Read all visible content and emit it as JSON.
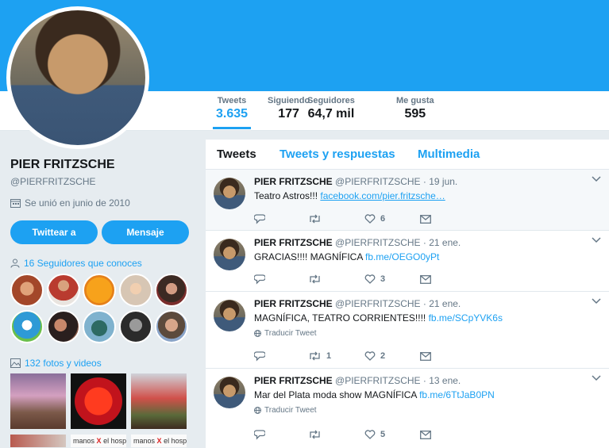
{
  "stats": [
    {
      "label": "Tweets",
      "value": "3.635"
    },
    {
      "label": "Siguiendo",
      "value": "177"
    },
    {
      "label": "Seguidores",
      "value": "64,7 mil"
    },
    {
      "label": "Me gusta",
      "value": "595"
    }
  ],
  "profile": {
    "name": "PIER FRITZSCHE",
    "handle": "@PIERFRITZSCHE",
    "joined": "Se unió en junio de 2010",
    "tweet_button": "Twittear a",
    "message_button": "Mensaje",
    "followers_you_know": "16 Seguidores que conoces",
    "photos_videos": "132 fotos y videos"
  },
  "tabs": [
    "Tweets",
    "Tweets y respuestas",
    "Multimedia"
  ],
  "tweets": [
    {
      "name": "PIER FRITZSCHE",
      "handle": "@PIERFRITZSCHE",
      "date": "· 19 jun.",
      "text": "Teatro Astros!!! ",
      "link": "facebook.com/pier.fritzsche…",
      "translate": "",
      "retweets": "",
      "likes": "6"
    },
    {
      "name": "PIER FRITZSCHE",
      "handle": "@PIERFRITZSCHE",
      "date": "· 21 ene.",
      "text": "GRACIAS!!!! MAGNÍFICA ",
      "link": "fb.me/OEGO0yPt",
      "translate": "",
      "retweets": "",
      "likes": "3"
    },
    {
      "name": "PIER FRITZSCHE",
      "handle": "@PIERFRITZSCHE",
      "date": "· 21 ene.",
      "text": "MAGNÍFICA, TEATRO CORRIENTES!!!! ",
      "link": "fb.me/SCpYVK6s",
      "translate": "Traducir Tweet",
      "retweets": "1",
      "likes": "2"
    },
    {
      "name": "PIER FRITZSCHE",
      "handle": "@PIERFRITZSCHE",
      "date": "· 13 ene.",
      "text": "Mar del Plata moda show MAGNÍFICA ",
      "link": "fb.me/6TtJaB0PN",
      "translate": "Traducir Tweet",
      "retweets": "",
      "likes": "5"
    }
  ],
  "photo_captions": [
    "manos",
    "el hosp",
    "manos",
    "el hosp"
  ],
  "colors": {
    "accent": "#1da1f2",
    "banner": "#1da1f2",
    "background": "#e6ecf0"
  }
}
